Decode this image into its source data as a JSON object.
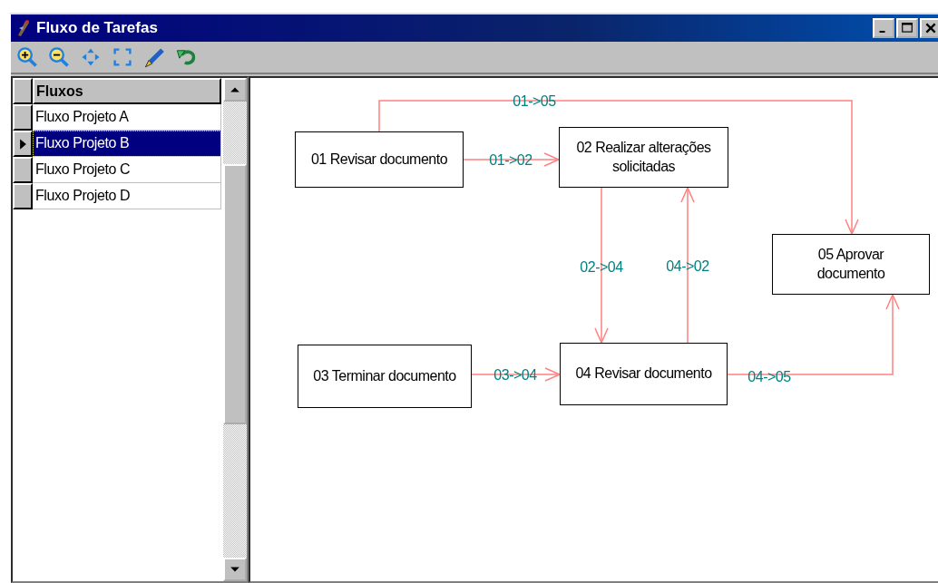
{
  "window": {
    "title": "Fluxo de Tarefas"
  },
  "grid": {
    "column": "Fluxos",
    "rows": [
      {
        "name": "Fluxo Projeto A",
        "selected": false
      },
      {
        "name": "Fluxo Projeto B",
        "selected": true
      },
      {
        "name": "Fluxo Projeto C",
        "selected": false
      },
      {
        "name": "Fluxo Projeto D",
        "selected": false
      }
    ]
  },
  "diagram": {
    "nodes": [
      {
        "text": "01 Revisar documento"
      },
      {
        "text": "02 Realizar alterações solicitadas"
      },
      {
        "text": "03 Terminar documento"
      },
      {
        "text": "04 Revisar documento"
      },
      {
        "text": "05 Aprovar documento"
      }
    ],
    "edges": [
      {
        "label": "01->05"
      },
      {
        "label": "01->02"
      },
      {
        "label": "02->04"
      },
      {
        "label": "04->02"
      },
      {
        "label": "03->04"
      },
      {
        "label": "04->05"
      }
    ]
  }
}
